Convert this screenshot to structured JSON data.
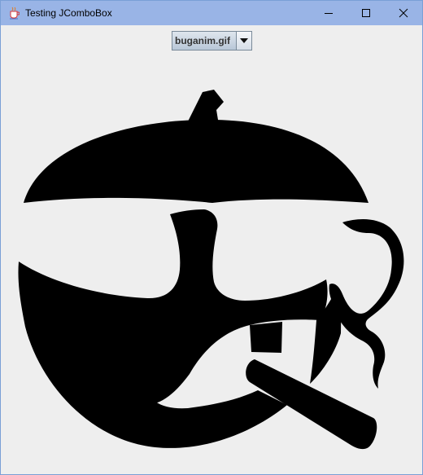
{
  "window": {
    "title": "Testing JComboBox",
    "title_icon": "java-cup-icon",
    "controls": [
      "minimize-icon",
      "maximize-icon",
      "close-icon"
    ]
  },
  "combo": {
    "selected": "buganim.gif",
    "arrow_icon": "chevron-down-icon"
  },
  "picture": {
    "subject": "black bug face smoking cigarette"
  },
  "colors": {
    "titlebar": "#99b4e6",
    "content_bg": "#eeeeee",
    "ink": "#000000"
  }
}
